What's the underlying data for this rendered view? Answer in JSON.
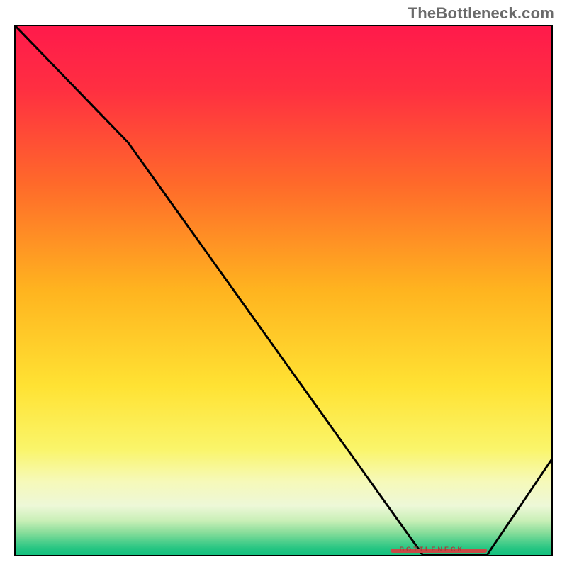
{
  "watermark": "TheBottleneck.com",
  "bottleneck_text": "BOTTLENECK",
  "chart_data": {
    "type": "line",
    "title": "",
    "xlabel": "",
    "ylabel": "",
    "xlim": [
      0,
      100
    ],
    "ylim": [
      0,
      100
    ],
    "x": [
      0,
      21,
      76,
      88,
      100
    ],
    "y": [
      100,
      78,
      0,
      0,
      18
    ],
    "bottleneck_band": {
      "x_start": 70,
      "x_end": 88,
      "y": 0.8
    },
    "gradient_stops": [
      {
        "offset": 0.0,
        "color": "#ff1a4b"
      },
      {
        "offset": 0.12,
        "color": "#ff2f41"
      },
      {
        "offset": 0.3,
        "color": "#ff6a2a"
      },
      {
        "offset": 0.5,
        "color": "#ffb41f"
      },
      {
        "offset": 0.68,
        "color": "#ffe233"
      },
      {
        "offset": 0.8,
        "color": "#faf56a"
      },
      {
        "offset": 0.86,
        "color": "#f6f9b8"
      },
      {
        "offset": 0.907,
        "color": "#edf8d8"
      },
      {
        "offset": 0.935,
        "color": "#c9efb7"
      },
      {
        "offset": 0.958,
        "color": "#87dd9a"
      },
      {
        "offset": 0.975,
        "color": "#4ecf8c"
      },
      {
        "offset": 0.988,
        "color": "#25c582"
      },
      {
        "offset": 1.0,
        "color": "#13c17e"
      }
    ]
  }
}
